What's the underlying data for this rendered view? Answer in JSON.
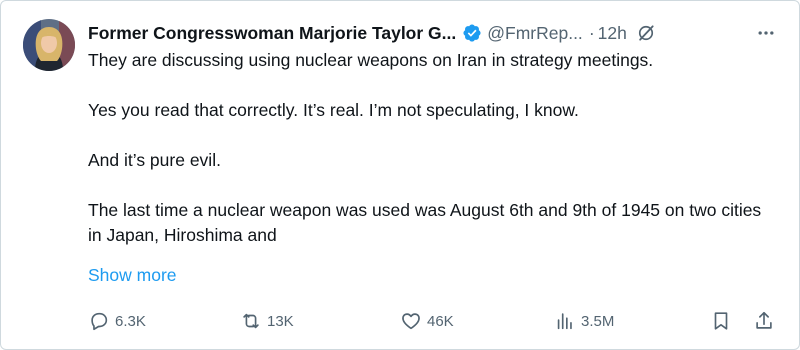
{
  "colors": {
    "accent": "#1d9bf0",
    "text_primary": "#0f1419",
    "text_secondary": "#536471",
    "border": "#cfd9de"
  },
  "tweet": {
    "author": {
      "display_name": "Former Congresswoman Marjorie Taylor G...",
      "handle": "@FmrRep...",
      "verified_icon": "verified-badge-icon",
      "avatar": "avatar"
    },
    "separator": "·",
    "time": "12h",
    "body": {
      "paragraphs": [
        "They are discussing using nuclear weapons on Iran in strategy meetings.",
        "Yes you read that correctly.  It’s real.  I’m not speculating, I know.",
        "And it’s pure evil.",
        "The last time a nuclear weapon was used was August 6th and 9th of 1945 on two cities in Japan, Hiroshima and"
      ]
    },
    "show_more": "Show more",
    "actions": {
      "replies": "6.3K",
      "reposts": "13K",
      "likes": "46K",
      "views": "3.5M"
    },
    "icons": {
      "grok": "grok-icon",
      "more": "more-icon",
      "reply": "reply-icon",
      "repost": "repost-icon",
      "like": "heart-icon",
      "views": "views-icon",
      "bookmark": "bookmark-icon",
      "share": "share-icon"
    }
  }
}
